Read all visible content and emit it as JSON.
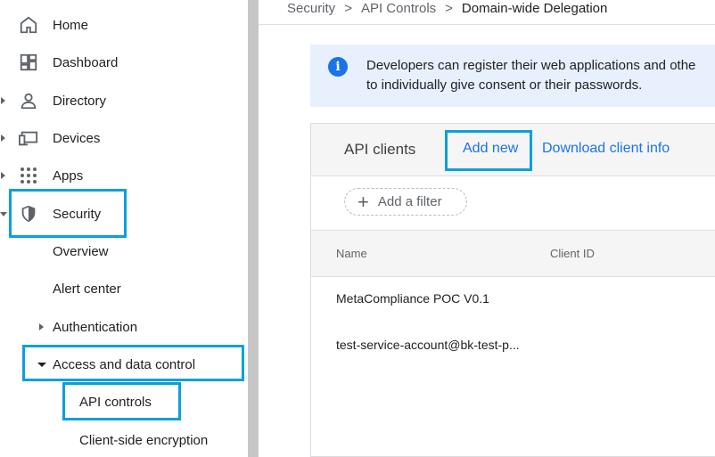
{
  "sidebar": {
    "items": [
      {
        "label": "Home",
        "icon": "home-icon"
      },
      {
        "label": "Dashboard",
        "icon": "dashboard-icon"
      },
      {
        "label": "Directory",
        "icon": "person-icon"
      },
      {
        "label": "Devices",
        "icon": "devices-icon"
      },
      {
        "label": "Apps",
        "icon": "apps-grid-icon"
      },
      {
        "label": "Security",
        "icon": "shield-icon"
      }
    ],
    "security_children": {
      "overview": "Overview",
      "alert_center": "Alert center",
      "authentication": "Authentication",
      "access_data_control": "Access and data control",
      "api_controls": "API controls",
      "client_side_encryption": "Client-side encryption"
    }
  },
  "breadcrumb": {
    "items": [
      "Security",
      "API Controls"
    ],
    "separator": ">",
    "current": "Domain-wide Delegation"
  },
  "info_banner": {
    "line1": "Developers can register their web applications and othe",
    "line2": "to individually give consent or their passwords."
  },
  "panel": {
    "title": "API clients",
    "add_new": "Add new",
    "download": "Download client info",
    "filter_label": "Add a filter",
    "columns": {
      "name": "Name",
      "client_id": "Client ID"
    },
    "rows": [
      {
        "name": "MetaCompliance POC V0.1"
      },
      {
        "name": "test-service-account@bk-test-p..."
      }
    ]
  },
  "colors": {
    "highlight": "#0aa0dc",
    "link": "#1a73e8",
    "banner_bg": "#e8f0fe"
  }
}
